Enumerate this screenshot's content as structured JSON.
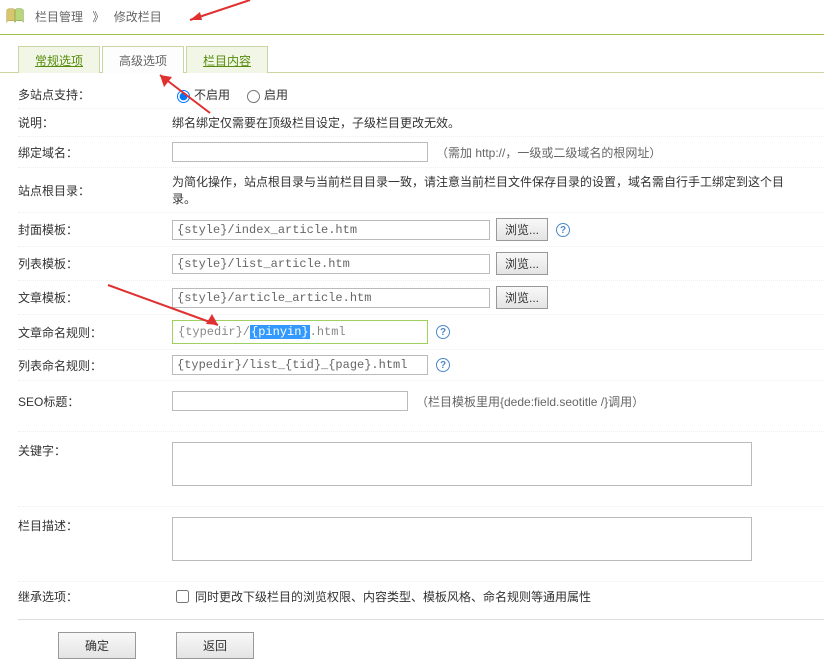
{
  "breadcrumb": {
    "root": "栏目管理",
    "sep": "》",
    "current": "修改栏目"
  },
  "tabs": {
    "regular": "常规选项",
    "advanced": "高级选项",
    "content": "栏目内容"
  },
  "fields": {
    "multisite": {
      "label": "多站点支持：",
      "opt_no": "不启用",
      "opt_yes": "启用"
    },
    "note": {
      "label": "说明：",
      "text": "绑名绑定仅需要在顶级栏目设定，子级栏目更改无效。"
    },
    "domain": {
      "label": "绑定域名：",
      "hint": "（需加 http://，一级或二级域名的根网址）"
    },
    "siteroot": {
      "label": "站点根目录：",
      "text": "为简化操作，站点根目录与当前栏目目录一致，请注意当前栏目文件保存目录的设置，域名需自行手工绑定到这个目录。"
    },
    "cover_tpl": {
      "label": "封面模板：",
      "value": "{style}/index_article.htm"
    },
    "list_tpl": {
      "label": "列表模板：",
      "value": "{style}/list_article.htm"
    },
    "article_tpl": {
      "label": "文章模板：",
      "value": "{style}/article_article.htm"
    },
    "article_rule": {
      "label": "文章命名规则：",
      "prefix": "{typedir}/",
      "sel": "{pinyin}",
      "suffix": ".html"
    },
    "list_rule": {
      "label": "列表命名规则：",
      "value": "{typedir}/list_{tid}_{page}.html"
    },
    "seo_title": {
      "label": "SEO标题：",
      "hint": "（栏目模板里用{dede:field.seotitle /}调用）"
    },
    "keywords": {
      "label": "关键字："
    },
    "description": {
      "label": "栏目描述："
    },
    "inherit": {
      "label": "继承选项：",
      "text": "同时更改下级栏目的浏览权限、内容类型、模板风格、命名规则等通用属性"
    }
  },
  "buttons": {
    "browse": "浏览...",
    "ok": "确定",
    "back": "返回"
  }
}
